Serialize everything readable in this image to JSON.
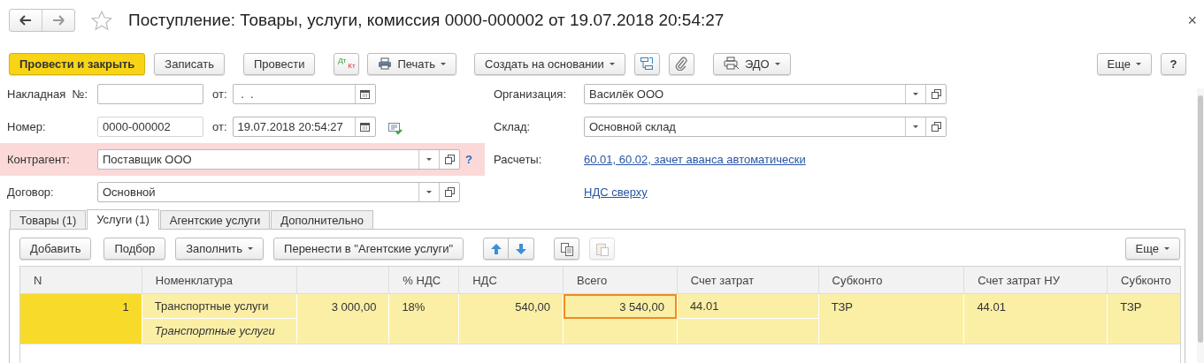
{
  "window": {
    "title": "Поступление: Товары, услуги, комиссия 0000-000002 от 19.07.2018 20:54:27",
    "close": "×"
  },
  "toolbar": {
    "left": [
      {
        "label": "Провести и закрыть",
        "kind": "primary"
      },
      {
        "label": "Записать",
        "kind": "button"
      },
      {
        "label": "Провести",
        "kind": "button"
      },
      {
        "kind": "dtkt",
        "top": "Дт",
        "bottom": "Кт"
      },
      {
        "label": "Печать",
        "kind": "print-menu"
      },
      {
        "label": "Создать на основании",
        "kind": "menu"
      },
      {
        "kind": "structure"
      },
      {
        "kind": "attach"
      },
      {
        "label": "ЭДО",
        "kind": "edo-menu"
      }
    ],
    "right": [
      {
        "label": "Еще",
        "kind": "menu"
      },
      {
        "label": "?",
        "kind": "button"
      }
    ]
  },
  "form": {
    "invoice": {
      "label": "Накладная  №:",
      "date_label": "от:",
      "date_value": " .  . "
    },
    "number": {
      "label": "Номер:",
      "value": "0000-000002",
      "date_label": "от:",
      "date_value": "19.07.2018 20:54:27"
    },
    "counterparty": {
      "label": "Контрагент:",
      "value": "Поставщик ООО",
      "highlighted": true,
      "help": "?"
    },
    "contract": {
      "label": "Договор:",
      "value": "Основной"
    },
    "organization": {
      "label": "Организация:",
      "value": "Василёк ООО"
    },
    "warehouse": {
      "label": "Склад:",
      "value": "Основной склад"
    },
    "settlements": {
      "label": "Расчеты:",
      "link": "60.01, 60.02, зачет аванса автоматически"
    },
    "vat_link": "НДС сверху"
  },
  "tabs": [
    {
      "label": "Товары (1)",
      "selected": false
    },
    {
      "label": "Услуги (1)",
      "selected": true
    },
    {
      "label": "Агентские услуги",
      "selected": false
    },
    {
      "label": "Дополнительно",
      "selected": false
    }
  ],
  "panel_toolbar": {
    "left": [
      {
        "label": "Добавить",
        "kind": "button",
        "disabled": false
      },
      {
        "label": "Подбор",
        "kind": "button",
        "disabled": false
      },
      {
        "label": "Заполнить",
        "kind": "menu",
        "disabled": false
      },
      {
        "label": "Перенести в \"Агентские услуги\"",
        "kind": "button",
        "disabled": false
      },
      {
        "kind": "move-up",
        "disabled": false
      },
      {
        "kind": "move-down",
        "disabled": false
      },
      {
        "kind": "copy",
        "disabled": false
      },
      {
        "kind": "paste",
        "disabled": true
      }
    ],
    "right": [
      {
        "label": "Еще",
        "kind": "menu",
        "disabled": false
      }
    ]
  },
  "table": {
    "columns": [
      {
        "label": "N"
      },
      {
        "label": "Номенклатура"
      },
      {},
      {
        "label": "% НДС"
      },
      {
        "label": "НДС"
      },
      {
        "label": "Всего"
      },
      {
        "label": "Счет затрат"
      },
      {
        "label": "Субконто"
      },
      {
        "label": "Счет затрат НУ"
      },
      {
        "label": "Субконто"
      }
    ],
    "rows": [
      {
        "selected": true,
        "cells": [
          {
            "text": "1",
            "split": false,
            "focused": false
          },
          {
            "text": "Транспортные услуги",
            "subtext": "Транспортные услуги",
            "split": true,
            "focused": false
          },
          {
            "text": "3 000,00",
            "split": false,
            "focused": false
          },
          {
            "text": "18%",
            "split": false,
            "focused": false
          },
          {
            "text": "540,00",
            "split": false,
            "focused": false
          },
          {
            "text": "3 540,00",
            "split": false,
            "focused": true
          },
          {
            "text": "44.01",
            "split": true,
            "focused": false
          },
          {
            "text": "ТЗР",
            "split": false,
            "focused": false
          },
          {
            "text": "44.01",
            "split": false,
            "focused": false
          },
          {
            "text": "ТЗР",
            "split": false,
            "focused": false
          }
        ]
      }
    ]
  }
}
